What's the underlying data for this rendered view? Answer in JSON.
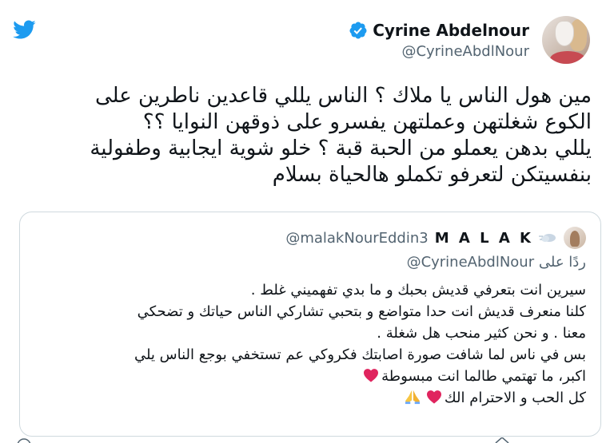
{
  "colors": {
    "brand": "#1d9bf0",
    "text": "#0f1419",
    "muted": "#536471",
    "border": "#cfd9de",
    "heart": "#e0245e"
  },
  "icons": {
    "logo": "twitter-bird-icon",
    "verified": "verified-badge-icon",
    "heart": "red-heart-emoji",
    "pray": "folded-hands-emoji"
  },
  "author": {
    "name": "Cyrine Abdelnour",
    "handle": "@CyrineAbdlNour"
  },
  "tweet": {
    "lines": [
      "مين هول الناس يا ملاك ؟ الناس يللي قاعدين ناطرين على",
      "الكوع  شغلتهن وعملتهن يفسرو على ذوقهن النوايا ؟؟",
      "يللي بدهن يعملو من الحبة قبة ؟ خلو شوية ايجابية وطفولية",
      "بنفسيتكن لتعرفو تكملو هالحياة بسلام"
    ]
  },
  "quoted": {
    "name": "M A L A K",
    "handle": "@malakNourEddin3",
    "reply_prefix": "ردًا على",
    "reply_to": "@CyrineAbdlNour",
    "lines": [
      "سيرين انت بتعرفي قديش بحبك و ما بدي تفهميني غلط .",
      "كلنا منعرف  قديش انت حدا متواضع و بتحبي تشاركي الناس حياتك و تضحكي",
      "معنا . و نحن كثير منحب هل شغلة .",
      "بس في ناس لما شافت صورة اصابتك فكروكي عم تستخفي بوجع الناس يلي",
      "اكبر، ما تهتمي طالما انت مبسوطة",
      "كل الحب و الاحترام الك"
    ]
  }
}
